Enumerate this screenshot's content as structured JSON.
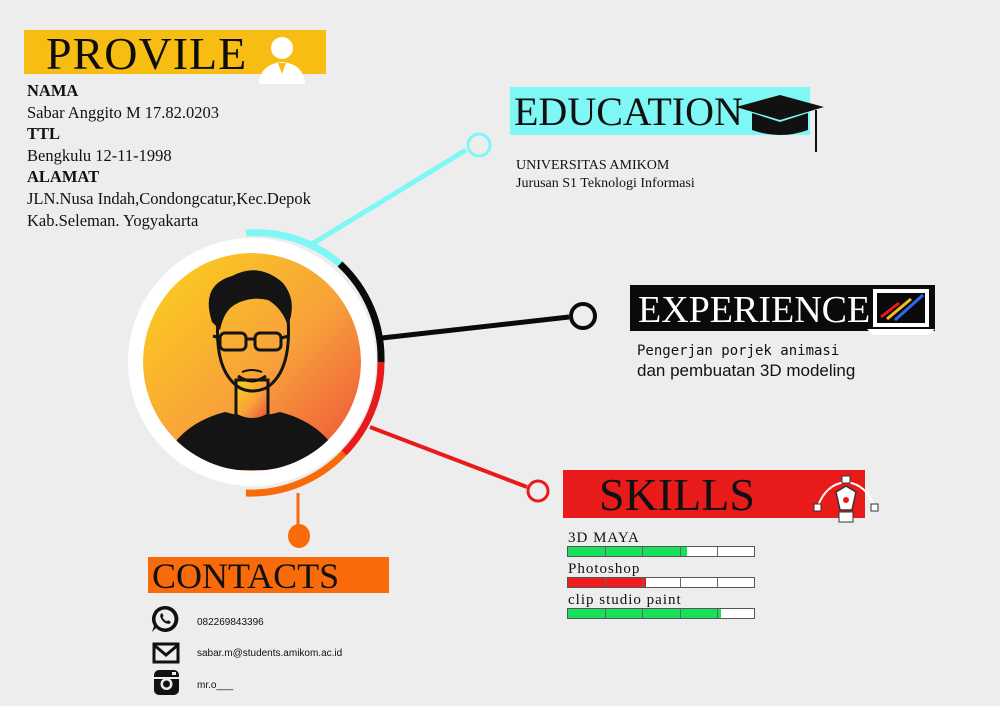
{
  "profile": {
    "title": "PROVILE",
    "name_label": "NAMA",
    "name_value": "Sabar Anggito M 17.82.0203",
    "ttl_label": "TTL",
    "ttl_value": "Bengkulu 12-11-1998",
    "address_label": "ALAMAT",
    "address_line1": "JLN.Nusa Indah,Condongcatur,Kec.Depok",
    "address_line2": "Kab.Seleman. Yogyakarta",
    "icon": "user-icon"
  },
  "education": {
    "title": "EDUCATION",
    "line1": "UNIVERSITAS AMIKOM",
    "line2": "Jurusan S1 Teknologi Informasi",
    "icon": "graduation-cap-icon"
  },
  "experience": {
    "title": "EXPERIENCE",
    "line1": "Pengerjan porjek animasi",
    "line2": "dan pembuatan 3D modeling",
    "icon": "laptop-chart-icon"
  },
  "skills": {
    "title": "SKILLS",
    "icon": "pen-tool-icon",
    "items": [
      {
        "name": "3D MAYA",
        "level": 0.64,
        "color": "#18e05a"
      },
      {
        "name": "Photoshop",
        "level": 0.42,
        "color": "#ee1c1c"
      },
      {
        "name": "clip studio paint",
        "level": 0.82,
        "color": "#18e05a"
      }
    ]
  },
  "contacts": {
    "title": "CONTACTS",
    "phone": "082269843396",
    "email": "sabar.m@students.amikom.ac.id",
    "instagram": "mr.o___",
    "icons": [
      "whatsapp-icon",
      "mail-icon",
      "instagram-icon"
    ]
  },
  "colors": {
    "profile": "#f7bd12",
    "education": "#7ef7f5",
    "experience": "#0a0a0a",
    "skills": "#e81a1a",
    "contacts": "#f96a0a"
  }
}
